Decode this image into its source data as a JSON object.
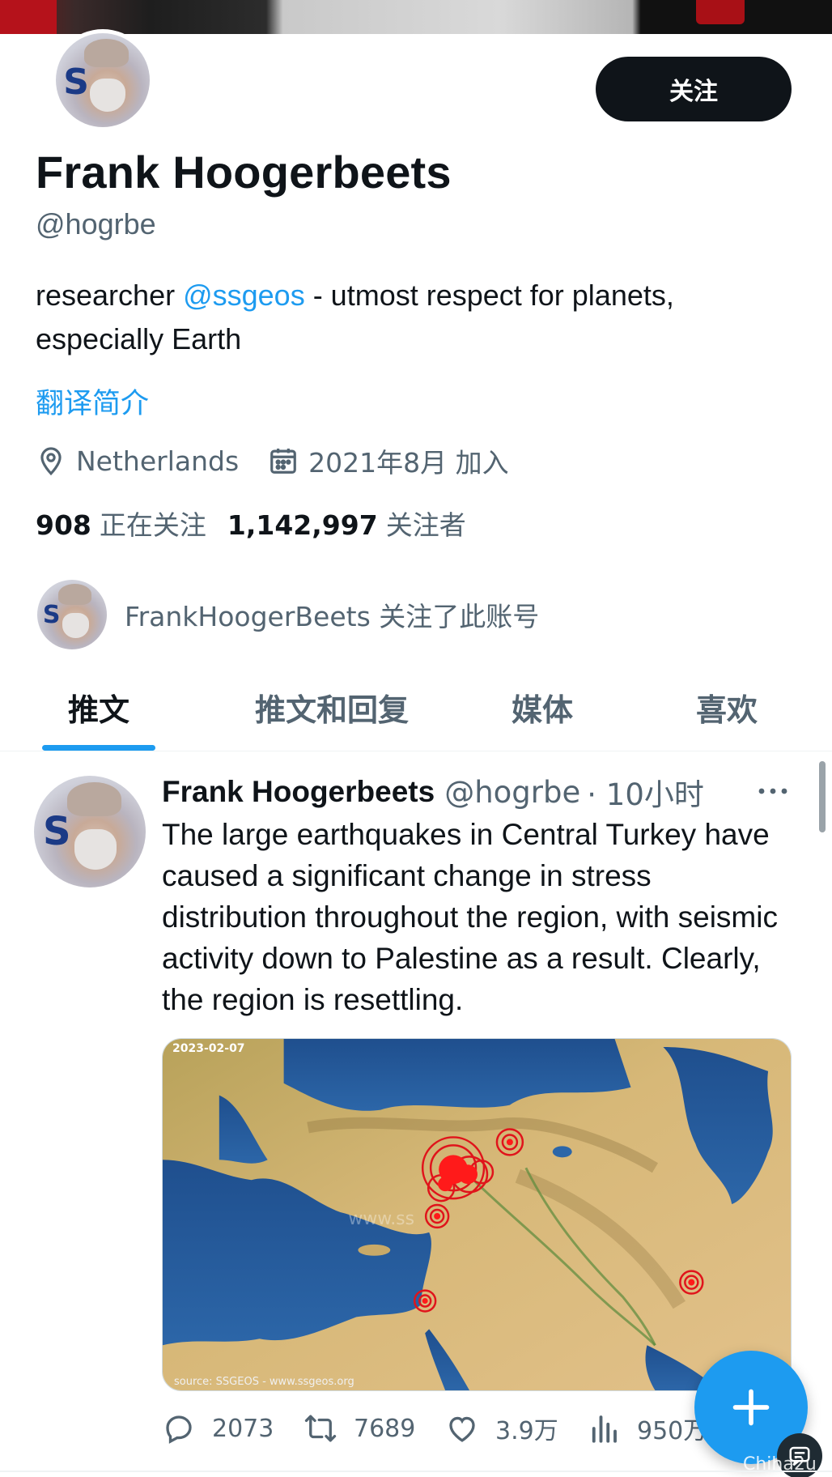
{
  "profile": {
    "name": "Frank Hoogerbeets",
    "handle": "@hogrbe",
    "avatar_letter": "S",
    "bio_prefix": "researcher ",
    "bio_mention": "@ssgeos",
    "bio_suffix": " - utmost respect for planets, especially Earth",
    "translate_label": "翻译简介",
    "location": "Netherlands",
    "joined": "2021年8月 加入",
    "following_count": "908",
    "following_label": "正在关注",
    "followers_count": "1,142,997",
    "followers_label": "关注者",
    "followed_by_text": "FrankHoogerBeets 关注了此账号"
  },
  "follow_button": {
    "label": "关注"
  },
  "tabs": [
    {
      "label": "推文",
      "active": true
    },
    {
      "label": "推文和回复",
      "active": false
    },
    {
      "label": "媒体",
      "active": false
    },
    {
      "label": "喜欢",
      "active": false
    }
  ],
  "tweet": {
    "author_name": "Frank Hoogerbeets",
    "author_handle": "@hogrbe",
    "time": "· 10小时",
    "text": "The large earthquakes in Central Turkey have caused a significant change in stress distribution throughout the region, with seismic activity down to Palestine as a result. Clearly, the region is resettling.",
    "media": {
      "date_label": "2023-02-07",
      "source_label": "source: SSGEOS - www.ssgeos.org",
      "watermark": "www.ss"
    },
    "actions": {
      "replies": "2073",
      "retweets": "7689",
      "likes": "3.9万",
      "views": "950万"
    }
  },
  "colors": {
    "accent": "#1d9bf0",
    "text_primary": "#0f1419",
    "text_secondary": "#536471",
    "button_dark": "#0f1419"
  },
  "overlay": {
    "watermark_text": "Chiha2u"
  }
}
